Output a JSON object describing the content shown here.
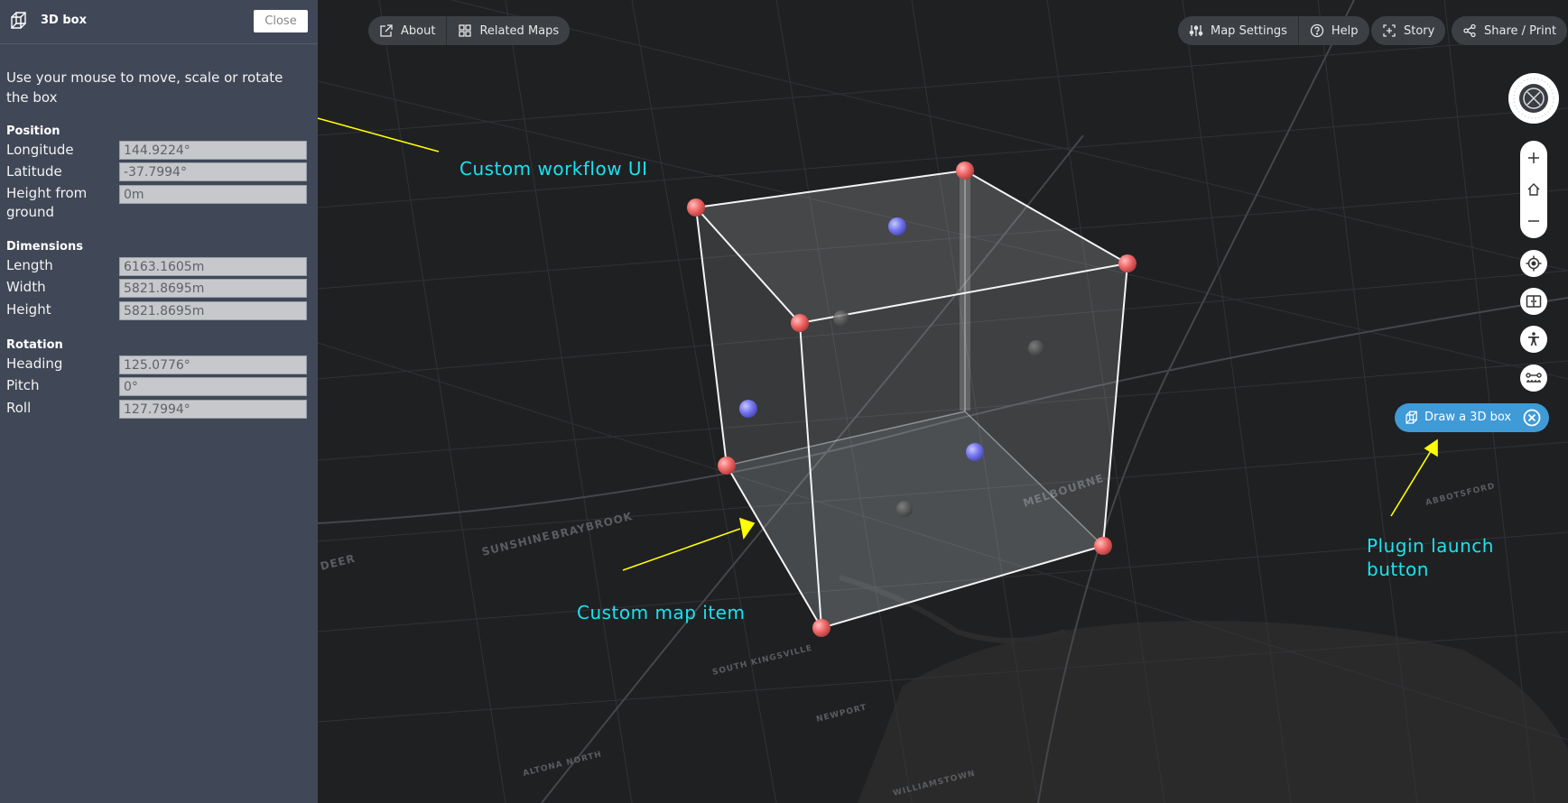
{
  "panel": {
    "title": "3D box",
    "close_label": "Close",
    "instructions": "Use your mouse to move, scale or rotate the box",
    "position": {
      "section": "Position",
      "longitude_label": "Longitude",
      "longitude": "144.9224°",
      "latitude_label": "Latitude",
      "latitude": "-37.7994°",
      "height_label": "Height from ground",
      "height": "0m"
    },
    "dimensions": {
      "section": "Dimensions",
      "length_label": "Length",
      "length": "6163.1605m",
      "width_label": "Width",
      "width": "5821.8695m",
      "height_label": "Height",
      "height": "5821.8695m"
    },
    "rotation": {
      "section": "Rotation",
      "heading_label": "Heading",
      "heading": "125.0776°",
      "pitch_label": "Pitch",
      "pitch": "0°",
      "roll_label": "Roll",
      "roll": "127.7994°"
    }
  },
  "toolbar": {
    "about": "About",
    "related_maps": "Related Maps",
    "map_settings": "Map Settings",
    "help": "Help",
    "story": "Story",
    "share_print": "Share / Print"
  },
  "map_controls": {
    "plugin_label": "Draw a 3D box"
  },
  "map_labels": [
    "SUNSHINE",
    "BRAYBROOK",
    "MELBOURNE",
    "SOUTH KINGSVILLE",
    "NEWPORT",
    "ALTONA NORTH",
    "WILLIAMSTOWN",
    "DEER",
    "ABBOTSFORD"
  ],
  "annotations": {
    "workflow_ui": "Custom workflow UI",
    "map_item": "Custom map item",
    "plugin_button": "Plugin launch button"
  },
  "colors": {
    "panel_bg": "#404857",
    "map_bg": "#1f2022",
    "accent": "#3f9ad6",
    "annotation_text": "#19e3f0",
    "annotation_arrow": "#ffff00",
    "corner_handle": "#f26a6a",
    "face_handle": "#7b7bf0"
  },
  "icons": {
    "panel_header": "3d-box-icon",
    "about": "external-link-icon",
    "related_maps": "grid-icon",
    "map_settings": "sliders-icon",
    "help": "question-circle-icon",
    "story": "story-icon",
    "share": "share-icon",
    "compass": "compass-icon",
    "zoom_in": "plus-icon",
    "home": "home-icon",
    "zoom_out": "minus-icon",
    "locate": "crosshair-icon",
    "split": "split-screen-icon",
    "accessibility": "accessibility-icon",
    "measure": "measure-icon",
    "close_plugin": "close-circle-icon"
  }
}
